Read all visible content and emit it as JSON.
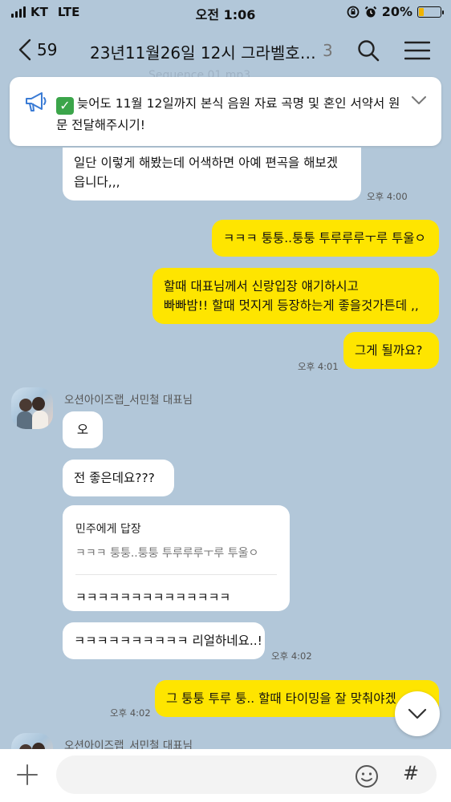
{
  "status_bar": {
    "carrier": "KT",
    "network": "LTE",
    "time": "오전 1:06",
    "battery_percent": "20%",
    "battery_level": 0.2
  },
  "header": {
    "back_count": "59",
    "title": "23년11월26일 12시 그라벨호…",
    "member_count": "3",
    "ghost_text": "Sequence 01.mp3"
  },
  "notice": {
    "text": "늦어도 11월 12일까지 본식 음원 자료 곡명 및 혼인 서약서 원문 전달해주시기!"
  },
  "messages": [
    {
      "type": "in",
      "text_line1": "일단 이렇게 해봤는데 어색하면 아예 편곡을 해보겠",
      "text_line2": "읍니다,,,",
      "time": "오후 4:00"
    },
    {
      "type": "out",
      "text": "ㅋㅋㅋ 퉁퉁..퉁퉁 투루루루ㅜ루 투울ㅇ"
    },
    {
      "type": "out",
      "text_line1": "할때 대표님께서 신랑입장 얘기하시고",
      "text_line2": "빠빠밤!! 할때 멋지게 등장하는게 좋을것가튼데 ,,"
    },
    {
      "type": "out",
      "text": "그게 될까요?",
      "time": "오후 4:01"
    }
  ],
  "sender": {
    "name": "오션아이즈랩_서민철 대표님"
  },
  "incoming": [
    {
      "text": "오"
    },
    {
      "text": "전 좋은데요???"
    },
    {
      "reply_to": "민주에게 답장",
      "quote": "ㅋㅋㅋ 퉁퉁..퉁퉁 투루루루ㅜ루 투울ㅇ",
      "text": "ㅋㅋㅋㅋㅋㅋㅋㅋㅋㅋㅋㅋㅋㅋ"
    },
    {
      "text": "ㅋㅋㅋㅋㅋㅋㅋㅋㅋㅋ 리얼하네요..!",
      "time": "오후 4:02"
    }
  ],
  "last_out": {
    "text": "그 퉁퉁 투루 퉁.. 할때 타이밍을 잘 맞춰야겠",
    "time": "오후 4:02"
  },
  "next_sender": {
    "name": "오션아이즈랩_서민철 대표님"
  },
  "input": {
    "placeholder": ""
  },
  "icons": {
    "back": "chevron-left-icon",
    "search": "search-icon",
    "menu": "menu-icon",
    "notice": "megaphone-icon",
    "collapse": "chevron-down-icon",
    "scroll": "chevron-down-icon",
    "plus": "plus-icon",
    "emoji": "emoji-icon",
    "hash": "hash-icon"
  },
  "colors": {
    "background": "#b2c7d9",
    "outgoing_bubble": "#fee500",
    "incoming_bubble": "#ffffff",
    "checkmark": "#3ba54a"
  }
}
